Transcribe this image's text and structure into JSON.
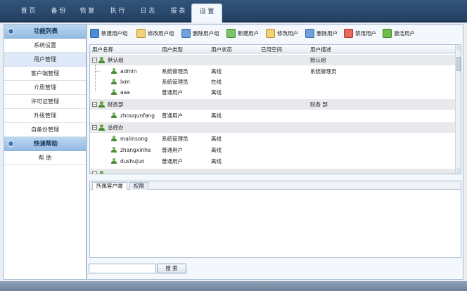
{
  "nav": {
    "tabs": [
      "首 页",
      "备 份",
      "恢 复",
      "执 行",
      "日 志",
      "报 表",
      "设 置"
    ],
    "active_index": 6
  },
  "sidebar": {
    "section1": "功能列表",
    "items": [
      "系统设置",
      "用户管理",
      "客户端管理",
      "介质管理",
      "许可证管理",
      "升级管理",
      "自备份管理"
    ],
    "active_index": 1,
    "section2": "快速帮助",
    "help": "帮 助"
  },
  "toolbar": {
    "new_group": "新建用户组",
    "edit_group": "修改用户组",
    "delete_group": "删除用户组",
    "new_user": "新建用户",
    "edit_user": "修改用户",
    "delete_user": "删除用户",
    "disable_user": "禁用用户",
    "activate_user": "激活用户"
  },
  "table": {
    "columns": [
      "用户名称",
      "用户类型",
      "用户状态",
      "已用空间",
      "用户描述"
    ],
    "groups": [
      {
        "name": "默认组",
        "description": "默认组",
        "users": [
          {
            "name": "admin",
            "type": "系统管理员",
            "status": "离线",
            "description": "系统管理员"
          },
          {
            "name": "lxm",
            "type": "系统管理员",
            "status": "在线",
            "description": ""
          },
          {
            "name": "aaa",
            "type": "普通用户",
            "status": "离线",
            "description": ""
          }
        ]
      },
      {
        "name": "财务部",
        "description": "财务 部",
        "users": [
          {
            "name": "zhouqunfang",
            "type": "普通用户",
            "status": "离线",
            "description": ""
          }
        ]
      },
      {
        "name": "总经办",
        "description": "",
        "users": [
          {
            "name": "malinsong",
            "type": "系统管理员",
            "status": "离线",
            "description": ""
          },
          {
            "name": "zhangxinhe",
            "type": "普通用户",
            "status": "离线",
            "description": ""
          },
          {
            "name": "dushuJun",
            "type": "普通用户",
            "status": "离线",
            "description": ""
          }
        ]
      }
    ]
  },
  "lower_tabs": [
    "所属客户端",
    "权限"
  ],
  "search": {
    "button": "搜 索",
    "value": ""
  }
}
